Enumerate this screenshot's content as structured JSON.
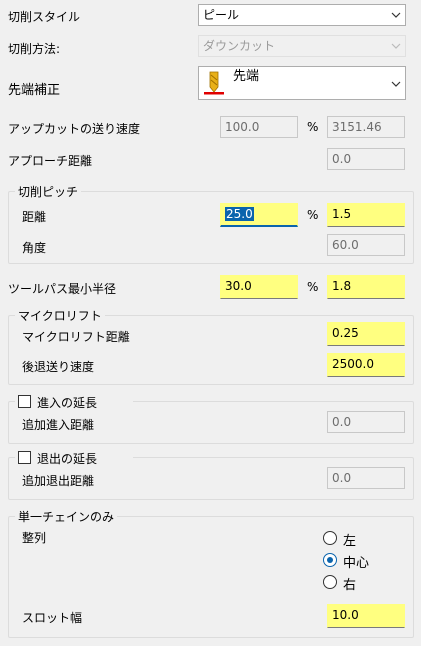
{
  "cut_style": {
    "label": "切削スタイル",
    "value": "ピール"
  },
  "cut_method": {
    "label": "切削方法:",
    "value": "ダウンカット"
  },
  "tip_comp": {
    "label": "先端補正",
    "value": "先端"
  },
  "approach_feed": {
    "label": "アップカットの送り速度",
    "percent": "100.0",
    "pct_sign": "%",
    "value": "3151.46"
  },
  "approach_dist": {
    "label": "アプローチ距離",
    "value": "0.0"
  },
  "pitch": {
    "title": "切削ピッチ",
    "distance": {
      "label": "距離",
      "percent": "25.0",
      "pct_sign": "%",
      "value": "1.5"
    },
    "angle": {
      "label": "角度",
      "value": "60.0"
    }
  },
  "min_radius": {
    "label": "ツールパス最小半径",
    "percent": "30.0",
    "pct_sign": "%",
    "value": "1.8"
  },
  "microlift": {
    "title": "マイクロリフト",
    "distance": {
      "label": "マイクロリフト距離",
      "value": "0.25"
    },
    "retract": {
      "label": "後退送り速度",
      "value": "2500.0"
    }
  },
  "entry_ext": {
    "title": "進入の延長",
    "add_label": "追加進入距離",
    "value": "0.0"
  },
  "exit_ext": {
    "title": "退出の延長",
    "add_label": "追加退出距離",
    "value": "0.0"
  },
  "single_chain": {
    "title": "単一チェインのみ",
    "align_label": "整列",
    "options": [
      "左",
      "中心",
      "右"
    ],
    "selected": "中心",
    "slot_label": "スロット幅",
    "slot_value": "10.0"
  }
}
